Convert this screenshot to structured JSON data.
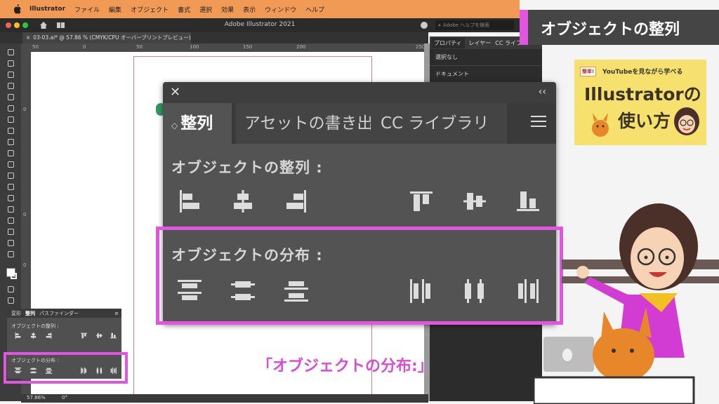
{
  "menubar": {
    "app_name": "Illustrator",
    "items": [
      "ファイル",
      "編集",
      "オブジェクト",
      "書式",
      "選択",
      "効果",
      "表示",
      "ウィンドウ",
      "ヘルプ"
    ]
  },
  "window": {
    "title": "Adobe Illustrator 2021",
    "help_search_placeholder": "Adobe ヘルプを検索"
  },
  "document_tab": "03-03.ai* @ 57.86 % (CMYK/CPU オーバープリントプレビュー)",
  "ruler_h": [
    "50",
    "0",
    "50",
    "100",
    "150",
    "200",
    "250"
  ],
  "ruler_v": [
    "0",
    "0",
    "0",
    "0"
  ],
  "status": {
    "zoom": "57.86%",
    "rotation": "0°"
  },
  "properties_panel": {
    "tabs": [
      "プロパティ",
      "レイヤー",
      "CC ライブ"
    ],
    "no_selection": "選択なし",
    "document": "ドキュメント"
  },
  "align_panel": {
    "tabs": [
      "整列",
      "アセットの書き出",
      "CC ライブラリ"
    ],
    "align_objects_heading": "オブジェクトの整列 :",
    "distribute_objects_heading": "オブジェクトの分布 :",
    "align_icons": [
      "align-left-icon",
      "align-horizontal-center-icon",
      "align-right-icon",
      "align-top-icon",
      "align-vertical-center-icon",
      "align-bottom-icon"
    ],
    "distribute_icons": [
      "distribute-top-icon",
      "distribute-vertical-center-icon",
      "distribute-bottom-icon",
      "distribute-left-icon",
      "distribute-horizontal-center-icon",
      "distribute-right-icon"
    ]
  },
  "small_panel": {
    "tabs": [
      "変形",
      "整列",
      "パスファインダー"
    ],
    "align_heading": "オブジェクトの整列 :",
    "distribute_heading": "オブジェクトの分布 :"
  },
  "caption": "「オブジェクトの分布:」",
  "video_title": "オブジェクトの整列",
  "channel_card": {
    "badge": "簡単!",
    "subtitle": "YouTubeを見ながら学べる",
    "line1": "Illustratorの",
    "line2": "使い方"
  },
  "colors": {
    "highlight": "#e056e0",
    "menubar": "#f09a55",
    "card": "#f7e16e"
  }
}
